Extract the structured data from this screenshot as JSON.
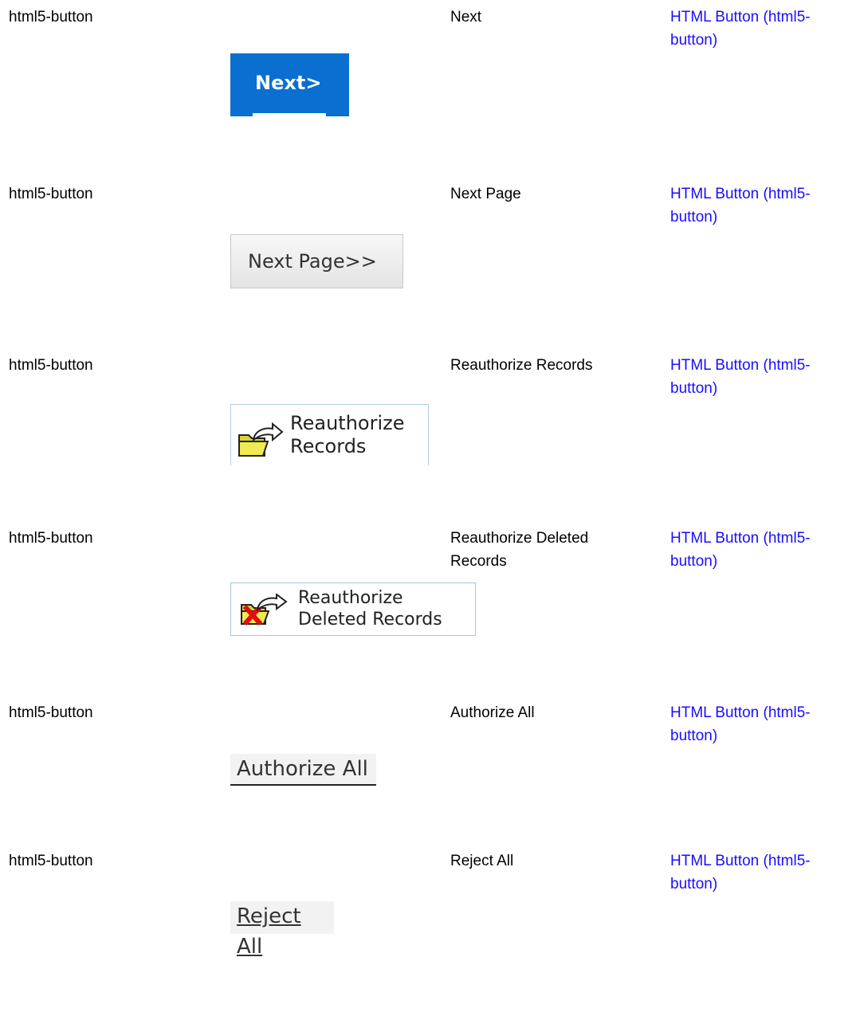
{
  "rows": [
    {
      "type": "html5-button",
      "name": "Next",
      "link": "HTML Button (html5-button)",
      "button_label": "Next>"
    },
    {
      "type": "html5-button",
      "name": "Next Page",
      "link": "HTML Button (html5-button)",
      "button_label": "Next Page>>"
    },
    {
      "type": "html5-button",
      "name": "Reauthorize Records",
      "link": "HTML Button (html5-button)",
      "button_label": "Reauthorize Records",
      "icon": "folder-arrow-icon"
    },
    {
      "type": "html5-button",
      "name": "Reauthorize Deleted Records",
      "link": "HTML Button (html5-button)",
      "button_label": "Reauthorize Deleted Records",
      "icon": "folder-delete-arrow-icon"
    },
    {
      "type": "html5-button",
      "name": "Authorize All",
      "link": "HTML Button (html5-button)",
      "button_label": "Authorize All"
    },
    {
      "type": "html5-button",
      "name": "Reject All",
      "link": "HTML Button (html5-button)",
      "button_label": "Reject All"
    }
  ],
  "colors": {
    "link": "#1a0dff",
    "next_button_bg": "#0a6fd1"
  }
}
